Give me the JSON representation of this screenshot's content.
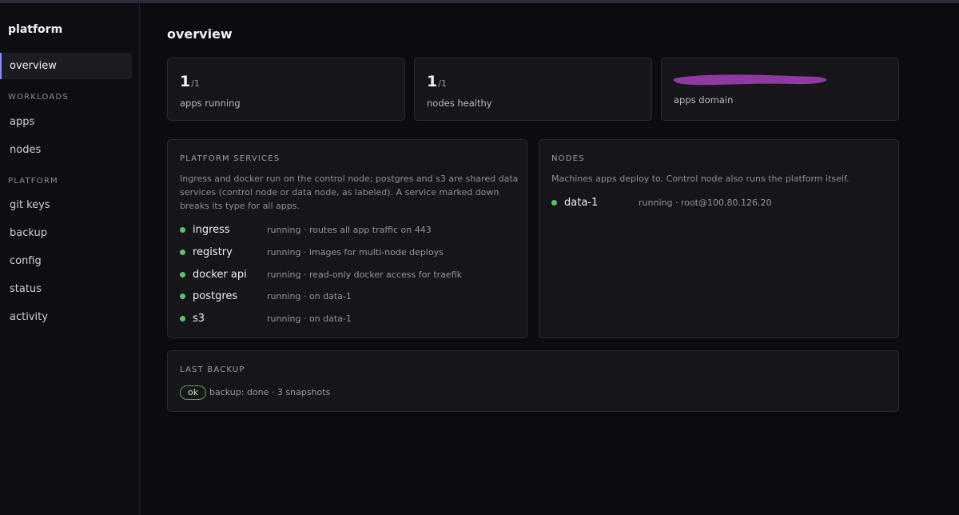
{
  "sidebar": {
    "brand": "platform",
    "items": {
      "overview": "overview",
      "apps": "apps",
      "nodes": "nodes",
      "git_keys": "git keys",
      "backup": "backup",
      "config": "config",
      "status": "status",
      "activity": "activity"
    },
    "sections": {
      "workloads": "WORKLOADS",
      "platform": "PLATFORM"
    }
  },
  "page": {
    "title": "overview"
  },
  "stats": {
    "apps": {
      "value": "1",
      "total": "/1",
      "label": "apps running"
    },
    "nodes": {
      "value": "1",
      "total": "/1",
      "label": "nodes healthy"
    },
    "domain": {
      "label": "apps domain",
      "redaction_color": "#8e3aa0"
    }
  },
  "services": {
    "heading": "PLATFORM SERVICES",
    "description": "Ingress and docker run on the control node; postgres and s3 are shared data services (control node or data node, as labeled). A service marked down breaks its type for all apps.",
    "items": [
      {
        "name": "ingress",
        "status": "running · routes all app traffic on 443"
      },
      {
        "name": "registry",
        "status": "running · images for multi-node deploys"
      },
      {
        "name": "docker api",
        "status": "running · read-only docker access for traefik"
      },
      {
        "name": "postgres",
        "status": "running · on data-1"
      },
      {
        "name": "s3",
        "status": "running · on data-1"
      }
    ]
  },
  "nodes_panel": {
    "heading": "NODES",
    "description": "Machines apps deploy to. Control node also runs the platform itself.",
    "items": [
      {
        "name": "data-1",
        "status": "running · root@100.80.126.20"
      }
    ]
  },
  "backup": {
    "heading": "LAST BACKUP",
    "badge": "ok",
    "text": "backup: done · 3 snapshots"
  },
  "colors": {
    "status_ok": "#5ec26a",
    "accent": "#8a8cff"
  }
}
